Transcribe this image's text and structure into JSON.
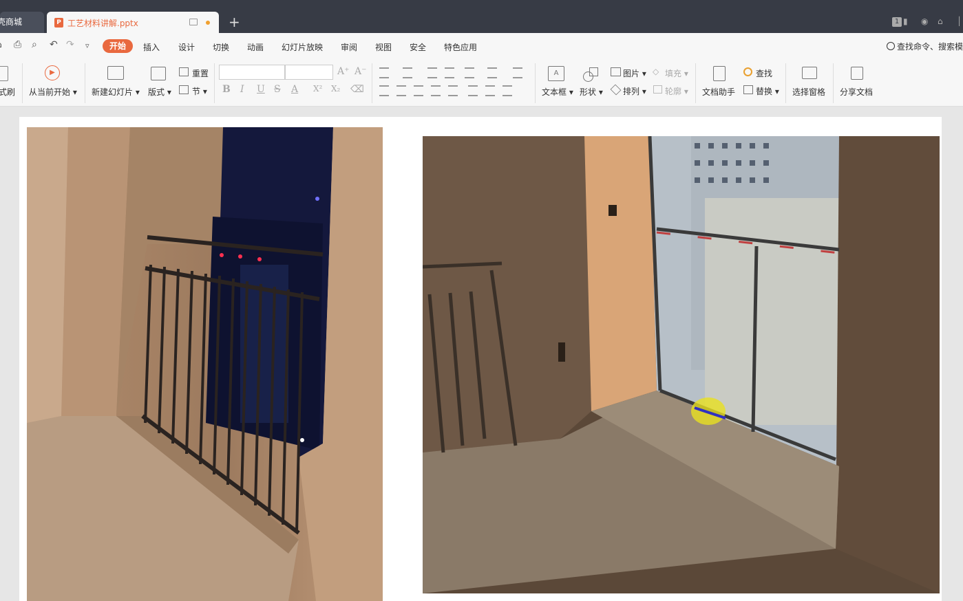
{
  "tabs": {
    "prev_tab_label": "壳商城",
    "active_tab_label": "工艺材料讲解.pptx",
    "new_tab_symbol": "+",
    "window_badge": "1"
  },
  "menu": {
    "items": [
      "开始",
      "插入",
      "设计",
      "切换",
      "动画",
      "幻灯片放映",
      "审阅",
      "视图",
      "安全",
      "特色应用"
    ],
    "search_label": "查找命令、搜索模"
  },
  "ribbon": {
    "format_painter": "式刷",
    "play_from_current": "从当前开始",
    "new_slide": "新建幻灯片",
    "layout": "版式",
    "reset": "重置",
    "section": "节",
    "textbox": "文本框",
    "shapes": "形状",
    "picture": "图片",
    "fill": "填充",
    "arrange": "排列",
    "outline": "轮廓",
    "doc_assistant": "文档助手",
    "find": "查找",
    "replace": "替换",
    "selection_pane": "选择窗格",
    "share_doc": "分享文档",
    "font_buttons": [
      "B",
      "I",
      "U",
      "S",
      "A",
      "X²",
      "X₂"
    ],
    "grow_font": "A⁺",
    "shrink_font": "A⁻"
  },
  "colors": {
    "accent": "#e9693f",
    "titlebar": "#373b45",
    "ribbon_bg": "#f7f7f7"
  }
}
